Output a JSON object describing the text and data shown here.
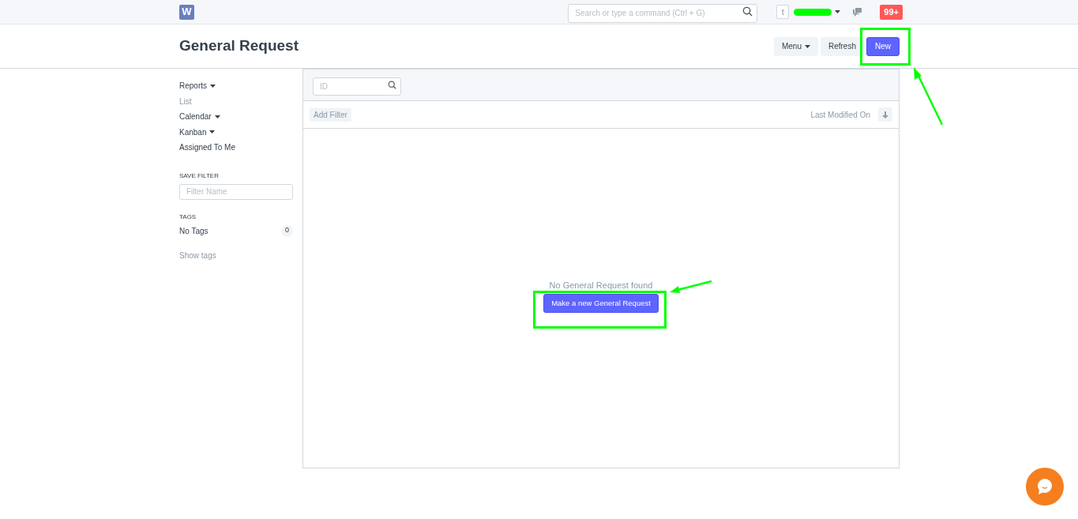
{
  "navbar": {
    "logo": "W",
    "search": {
      "placeholder": "Search or type a command (Ctrl + G)"
    },
    "avatar": "t",
    "notifications": "99+"
  },
  "page": {
    "title": "General Request",
    "buttons": [
      {
        "label": "Menu",
        "kind": "dropdown"
      },
      {
        "label": "Refresh",
        "kind": "default"
      },
      {
        "label": "New",
        "kind": "primary"
      }
    ]
  },
  "sidebar": {
    "items": [
      {
        "label": "Reports",
        "dropdown": true,
        "selected": false
      },
      {
        "label": "List",
        "dropdown": false,
        "selected": true
      },
      {
        "label": "Calendar",
        "dropdown": true,
        "selected": false
      },
      {
        "label": "Kanban",
        "dropdown": true,
        "selected": false
      },
      {
        "label": "Assigned To Me",
        "dropdown": false,
        "selected": false
      }
    ],
    "save_filter": {
      "heading": "SAVE FILTER",
      "placeholder": "Filter Name"
    },
    "tags": {
      "heading": "TAGS",
      "label": "No Tags",
      "count": "0",
      "link": "Show tags"
    }
  },
  "list": {
    "id_filter": {
      "placeholder": "ID"
    },
    "add_filter": "Add Filter",
    "sort_label": "Last Modified On",
    "empty_message": "No General Request found",
    "empty_button": "Make a new General Request"
  }
}
